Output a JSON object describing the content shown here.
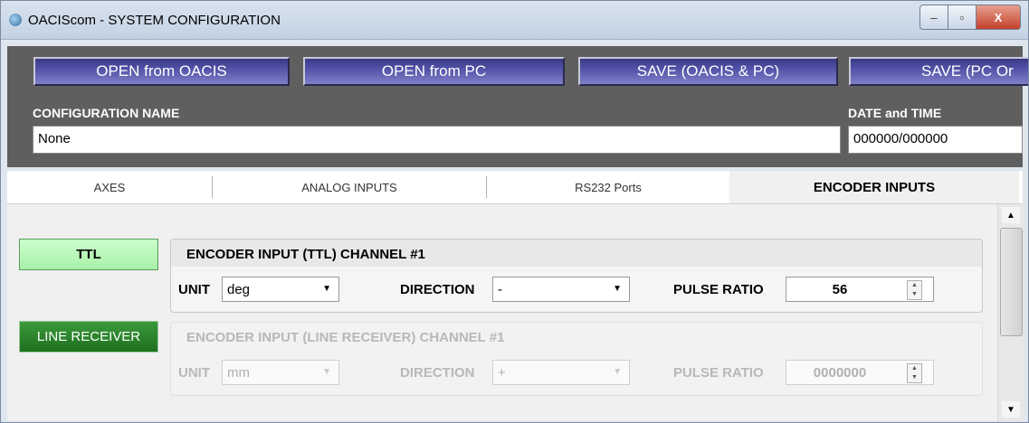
{
  "window": {
    "title": "OACIScom - SYSTEM CONFIGURATION",
    "minimize": "–",
    "maximize": "▫",
    "close": "X"
  },
  "toolbar": {
    "open_oacis": "OPEN from OACIS",
    "open_pc": "OPEN from PC",
    "save_oacis_pc": "SAVE  (OACIS & PC)",
    "save_pc_only": "SAVE (PC Or"
  },
  "config": {
    "name_label": "CONFIGURATION NAME",
    "name_value": "None",
    "datetime_label": "DATE and TIME",
    "datetime_value": "000000/000000"
  },
  "tabs": [
    "AXES",
    "ANALOG INPUTS",
    "RS232 Ports",
    "ENCODER INPUTS"
  ],
  "active_tab": "ENCODER INPUTS",
  "side": {
    "ttl": "TTL",
    "line_receiver": "LINE RECEIVER"
  },
  "ttl_group": {
    "title": "ENCODER INPUT (TTL) CHANNEL #1",
    "unit_label": "UNIT",
    "unit_value": "deg",
    "direction_label": "DIRECTION",
    "direction_value": "-",
    "pulse_label": "PULSE RATIO",
    "pulse_value": "56"
  },
  "lr_group": {
    "title": "ENCODER INPUT (LINE RECEIVER) CHANNEL #1",
    "unit_label": "UNIT",
    "unit_value": "mm",
    "direction_label": "DIRECTION",
    "direction_value": "+",
    "pulse_label": "PULSE RATIO",
    "pulse_value": "0000000"
  },
  "icons": {
    "dropdown": "▼",
    "spin_up": "▲",
    "spin_down": "▼",
    "scroll_up": "▲",
    "scroll_down": "▼"
  }
}
